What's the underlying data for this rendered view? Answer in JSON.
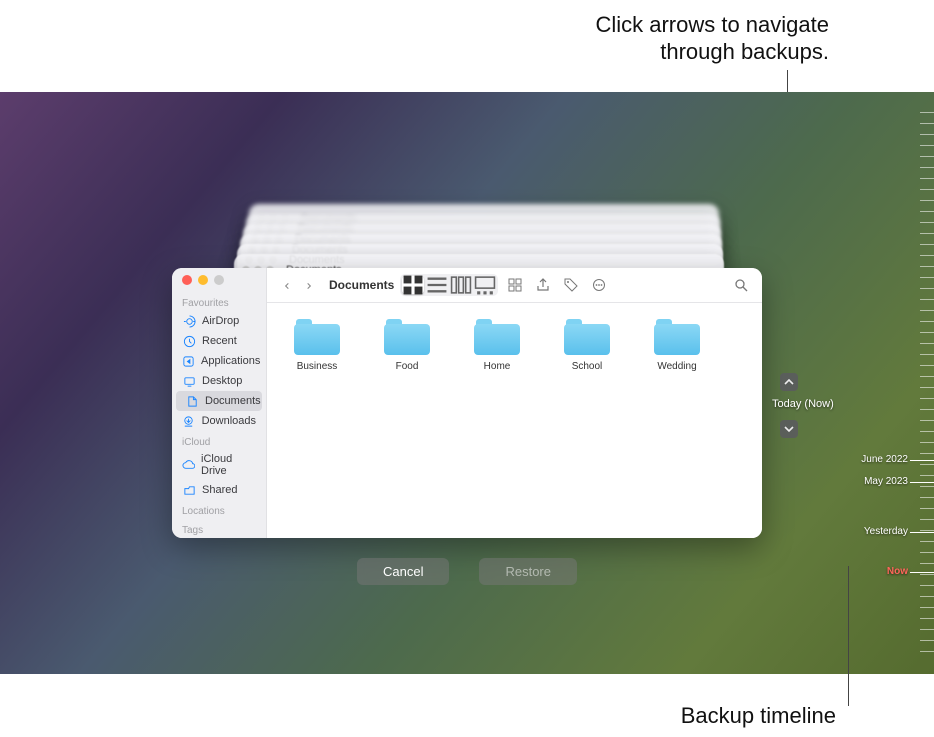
{
  "callouts": {
    "top_line1": "Click arrows to navigate",
    "top_line2": "through backups.",
    "bottom": "Backup timeline"
  },
  "stack_title": "Documents",
  "finder": {
    "title": "Documents",
    "sidebar": {
      "favourites": {
        "header": "Favourites",
        "items": [
          {
            "label": "AirDrop"
          },
          {
            "label": "Recent"
          },
          {
            "label": "Applications"
          },
          {
            "label": "Desktop"
          },
          {
            "label": "Documents",
            "selected": true
          },
          {
            "label": "Downloads"
          }
        ]
      },
      "icloud": {
        "header": "iCloud",
        "items": [
          {
            "label": "iCloud Drive"
          },
          {
            "label": "Shared"
          }
        ]
      },
      "locations": {
        "header": "Locations"
      },
      "tags": {
        "header": "Tags"
      }
    },
    "folders": [
      {
        "name": "Business"
      },
      {
        "name": "Food"
      },
      {
        "name": "Home"
      },
      {
        "name": "School"
      },
      {
        "name": "Wedding"
      }
    ]
  },
  "controls": {
    "cancel": "Cancel",
    "restore": "Restore",
    "today": "Today (Now)"
  },
  "timeline": [
    {
      "label": "June 2022"
    },
    {
      "label": "May 2023"
    },
    {
      "label": "Yesterday"
    },
    {
      "label": "Now",
      "now": true
    }
  ]
}
